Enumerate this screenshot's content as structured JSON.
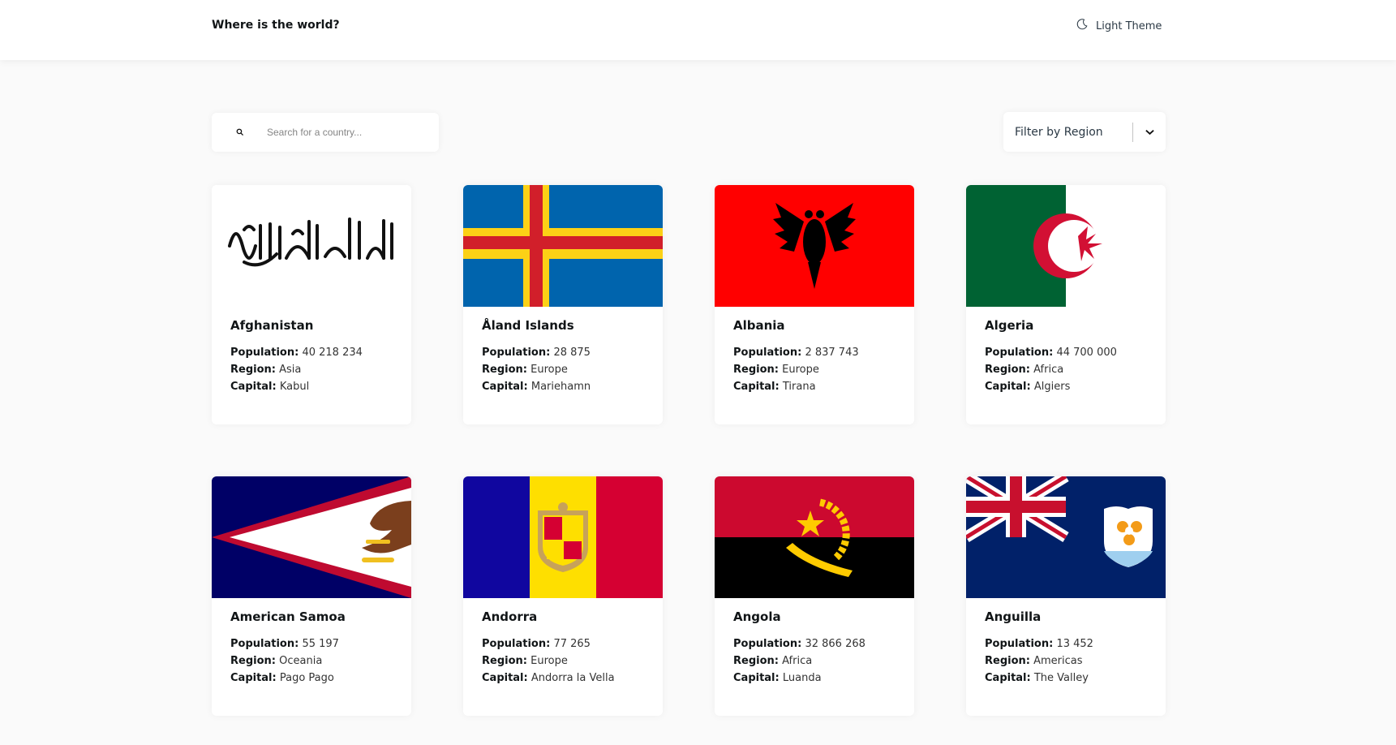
{
  "header": {
    "title": "Where is the world?",
    "theme_label": "Light Theme"
  },
  "search": {
    "placeholder": "Search for a country..."
  },
  "filter": {
    "label": "Filter by Region"
  },
  "labels": {
    "population": "Population:",
    "region": "Region:",
    "capital": "Capital:"
  },
  "countries": [
    {
      "name": "Afghanistan",
      "population": "40 218 234",
      "region": "Asia",
      "capital": "Kabul",
      "flag": "afghanistan-flag"
    },
    {
      "name": "Åland Islands",
      "population": "28 875",
      "region": "Europe",
      "capital": "Mariehamn",
      "flag": "aland-flag"
    },
    {
      "name": "Albania",
      "population": "2 837 743",
      "region": "Europe",
      "capital": "Tirana",
      "flag": "albania-flag"
    },
    {
      "name": "Algeria",
      "population": "44 700 000",
      "region": "Africa",
      "capital": "Algiers",
      "flag": "algeria-flag"
    },
    {
      "name": "American Samoa",
      "population": "55 197",
      "region": "Oceania",
      "capital": "Pago Pago",
      "flag": "american-samoa-flag"
    },
    {
      "name": "Andorra",
      "population": "77 265",
      "region": "Europe",
      "capital": "Andorra la Vella",
      "flag": "andorra-flag"
    },
    {
      "name": "Angola",
      "population": "32 866 268",
      "region": "Africa",
      "capital": "Luanda",
      "flag": "angola-flag"
    },
    {
      "name": "Anguilla",
      "population": "13 452",
      "region": "Americas",
      "capital": "The Valley",
      "flag": "anguilla-flag"
    }
  ],
  "colors": {
    "background": "#fafafa",
    "card": "#ffffff",
    "text": "#111517"
  }
}
